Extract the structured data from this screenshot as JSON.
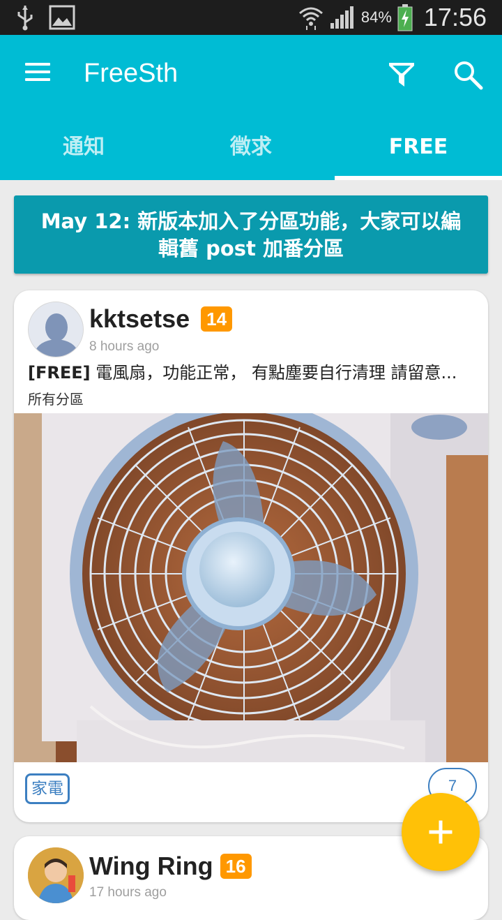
{
  "status_bar": {
    "battery_percent": "84%",
    "time": "17:56",
    "icons": [
      "usb-icon",
      "image-icon",
      "wifi-icon",
      "signal-icon",
      "battery-charging-icon"
    ]
  },
  "app_bar": {
    "title": "FreeSth",
    "icons": [
      "menu-icon",
      "filter-icon",
      "search-icon"
    ]
  },
  "tabs": [
    {
      "label": "通知",
      "active": false
    },
    {
      "label": "徵求",
      "active": false
    },
    {
      "label": "FREE",
      "active": true
    }
  ],
  "banner": {
    "line1": "May 12: 新版本加入了分區功能，大家可以編",
    "line2": "輯舊 post 加番分區"
  },
  "posts": [
    {
      "username": "kktsetse",
      "badge": "14",
      "time": "8 hours ago",
      "title_prefix": "[FREE]",
      "title_text": " 電風扇，功能正常， 有點塵要自行清理 請留意...",
      "region": "所有分區",
      "tag": "家電",
      "comments": "7"
    },
    {
      "username": "Wing Ring",
      "badge": "16",
      "time": "17 hours ago"
    }
  ],
  "fab": {
    "icon": "plus-icon"
  },
  "colors": {
    "primary": "#00bcd4",
    "banner": "#0a9aad",
    "badge": "#ff9800",
    "fab": "#ffc107",
    "tag": "#3c7fc1"
  }
}
